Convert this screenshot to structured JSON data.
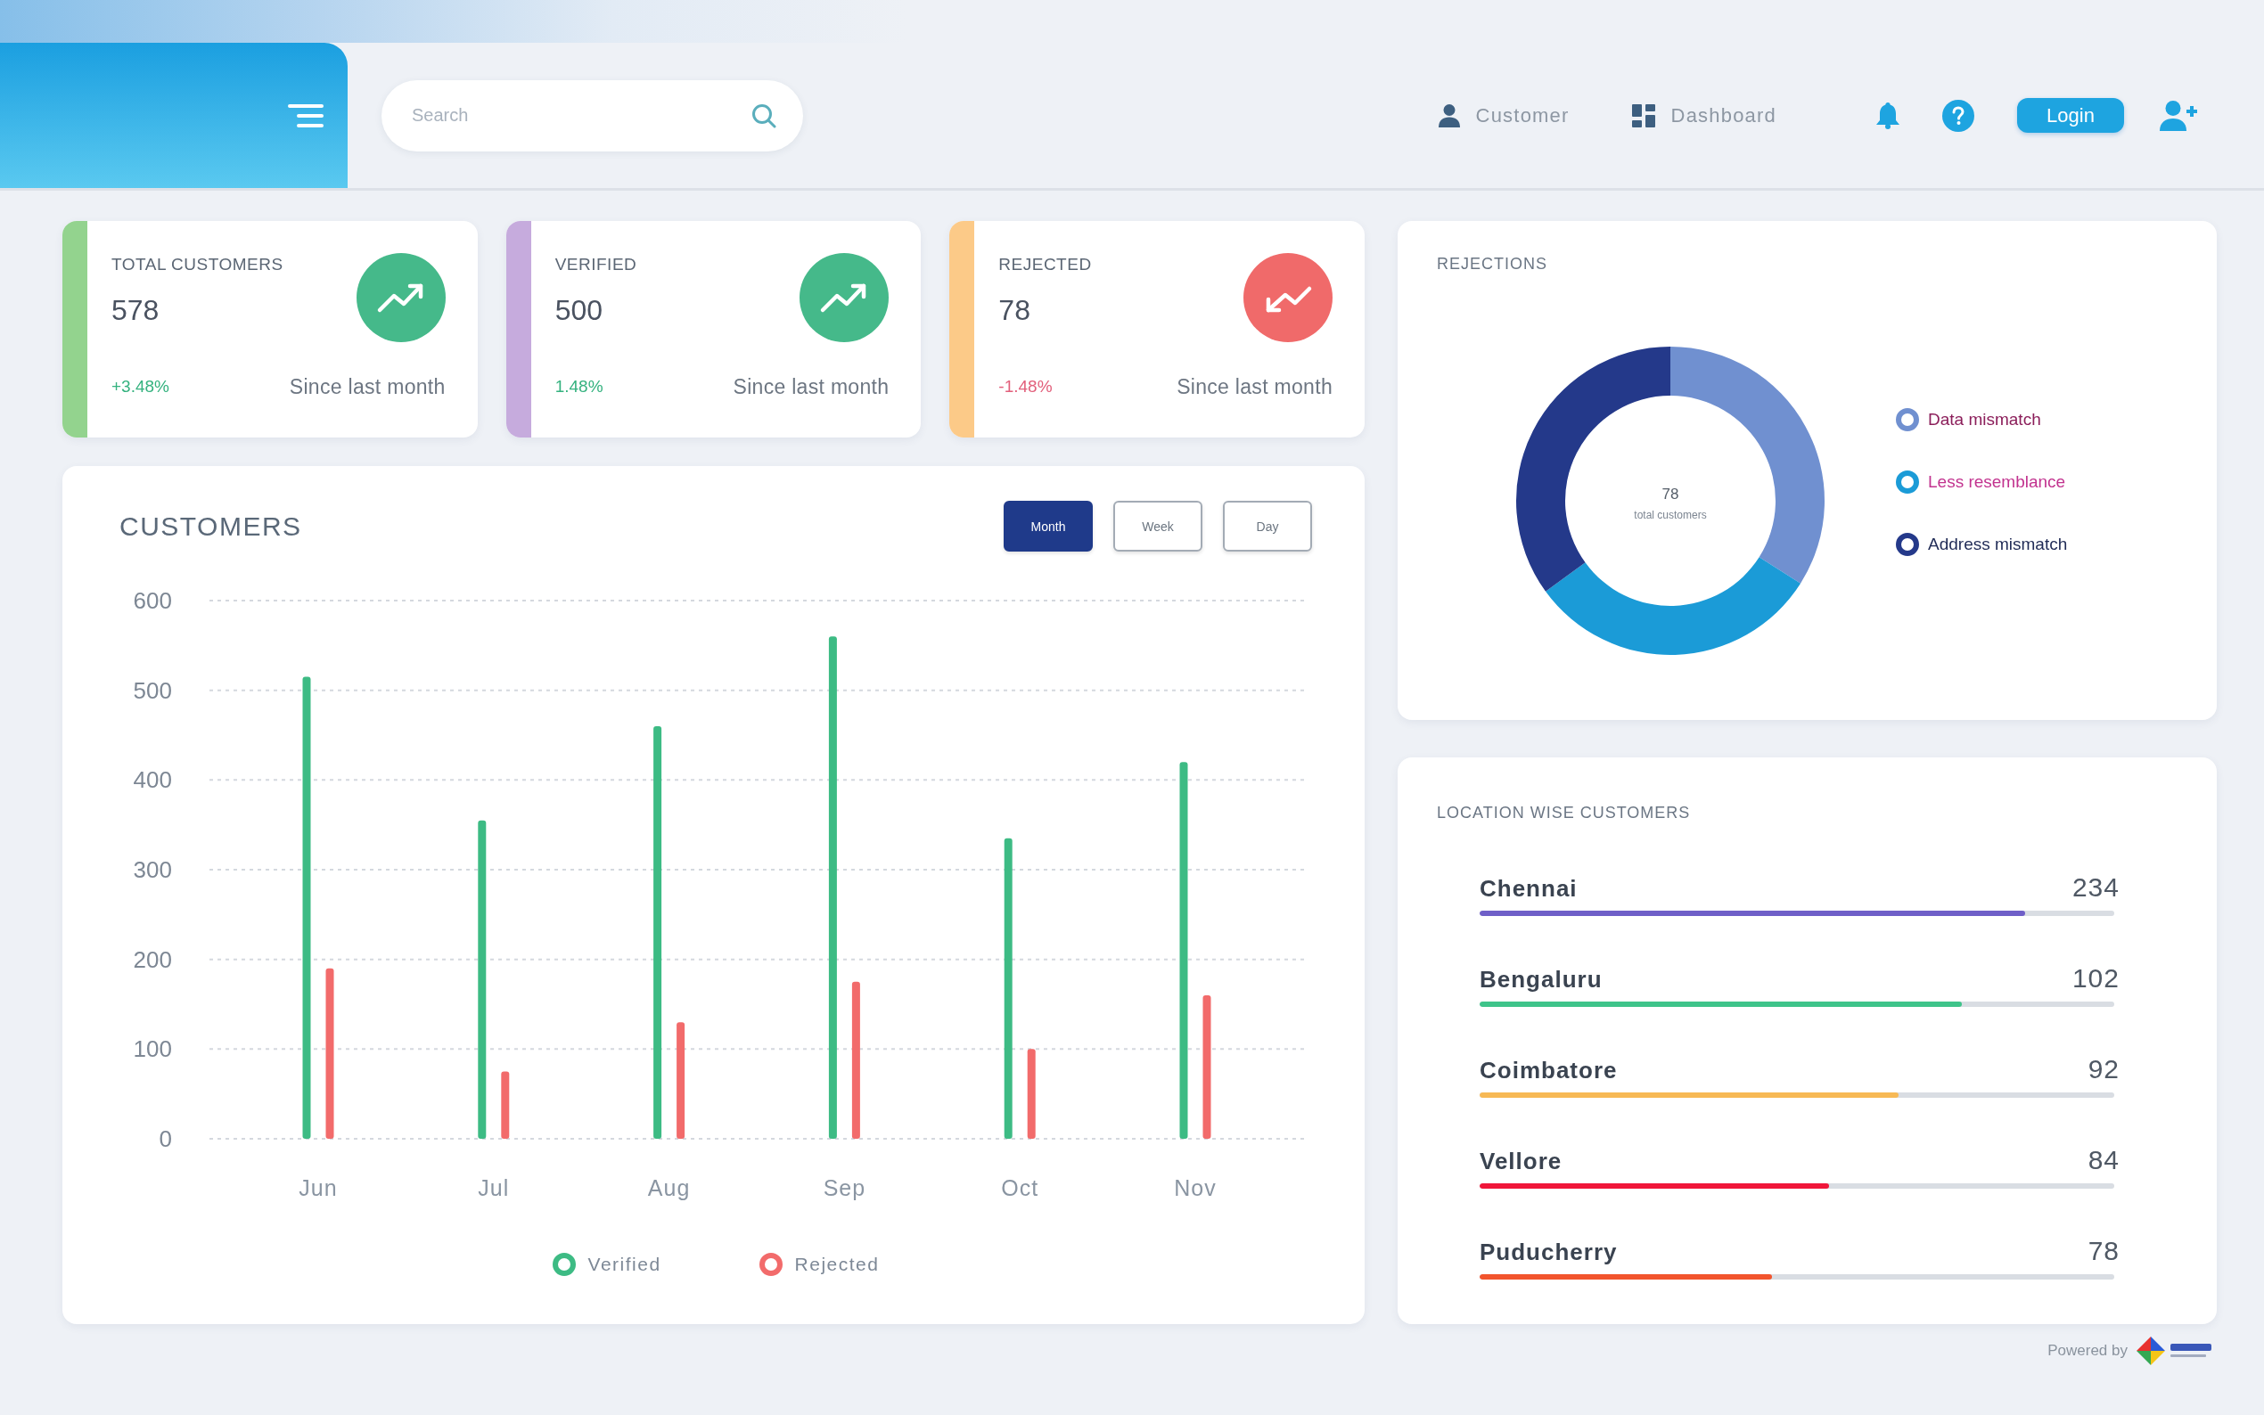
{
  "header": {
    "search": {
      "placeholder": "Search"
    },
    "nav": [
      {
        "label": "Customer"
      },
      {
        "label": "Dashboard"
      }
    ],
    "login_button": "Login"
  },
  "stats": [
    {
      "title": "TOTAL CUSTOMERS",
      "value": "578",
      "change": "+3.48%",
      "rising": true,
      "note": "Since last month",
      "color": "#93d38e"
    },
    {
      "title": "VERIFIED",
      "value": "500",
      "change": "1.48%",
      "rising": true,
      "note": "Since last month",
      "color": "#c6abdd"
    },
    {
      "title": "REJECTED",
      "value": "78",
      "change": "-1.48%",
      "rising": false,
      "note": "Since last month",
      "color": "#fcca88"
    }
  ],
  "customers_chart": {
    "title": "CUSTOMERS",
    "periods": [
      {
        "label": "Month",
        "selected": true
      },
      {
        "label": "Week",
        "selected": false
      },
      {
        "label": "Day",
        "selected": false
      }
    ],
    "chart_data": {
      "type": "bar",
      "categories": [
        "Jun",
        "Jul",
        "Aug",
        "Sep",
        "Oct",
        "Nov"
      ],
      "series": [
        {
          "name": "Verified",
          "color": "#3dbb84",
          "values": [
            515,
            355,
            460,
            560,
            335,
            420
          ]
        },
        {
          "name": "Rejected",
          "color": "#f26b6b",
          "values": [
            190,
            75,
            130,
            175,
            100,
            160
          ]
        }
      ],
      "ylim": [
        0,
        600
      ],
      "yticks": [
        0,
        100,
        200,
        300,
        400,
        500,
        600
      ],
      "grid": true
    }
  },
  "rejections": {
    "title": "REJECTIONS",
    "total": "78",
    "total_label": "total customers",
    "chart_data": {
      "type": "donut",
      "categories": [
        "Data mismatch",
        "Less resemblance",
        "Address mismatch"
      ],
      "values": [
        34,
        31,
        35
      ],
      "colors": [
        "#7090d0",
        "#1b9bd7",
        "#24398a"
      ]
    }
  },
  "locations": {
    "title": "LOCATION WISE CUSTOMERS",
    "rows": [
      {
        "name": "Chennai",
        "count": "234",
        "level": 0.86,
        "color": "#6f5fc8"
      },
      {
        "name": "Bengaluru",
        "count": "102",
        "level": 0.76,
        "color": "#3ec48a"
      },
      {
        "name": "Coimbatore",
        "count": "92",
        "level": 0.66,
        "color": "#f7b955"
      },
      {
        "name": "Vellore",
        "count": "84",
        "level": 0.55,
        "color": "#f0163a"
      },
      {
        "name": "Puducherry",
        "count": "78",
        "level": 0.46,
        "color": "#f2542d"
      }
    ]
  },
  "footer": {
    "powered_by": "Powered by"
  }
}
